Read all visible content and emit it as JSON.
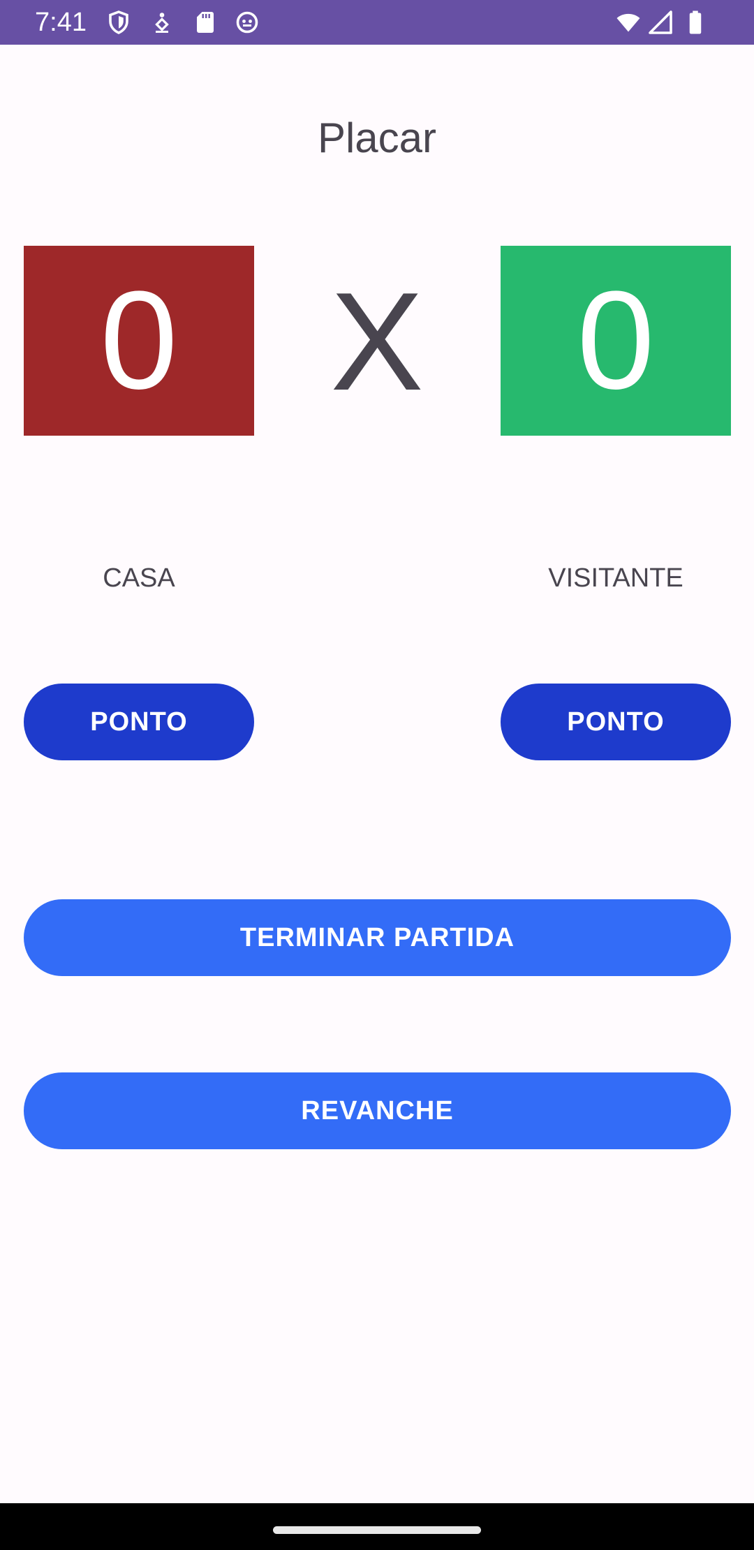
{
  "status_bar": {
    "time": "7:41",
    "background": "#6750a4",
    "left_icons": [
      "shield-icon",
      "accessibility-icon",
      "sd-card-icon",
      "robot-face-icon"
    ],
    "right_icons": [
      "wifi-icon",
      "cell-signal-icon",
      "battery-icon"
    ]
  },
  "header": {
    "title": "Placar"
  },
  "scoreboard": {
    "home_score": "0",
    "away_score": "0",
    "separator": "X",
    "home_color": "#9e2829",
    "away_color": "#27b96e"
  },
  "teams": {
    "home_label": "CASA",
    "away_label": "VISITANTE"
  },
  "buttons": {
    "home_point_label": "PONTO",
    "away_point_label": "PONTO",
    "end_match_label": "TERMINAR PARTIDA",
    "rematch_label": "REVANCHE",
    "point_color": "#1e3bcc",
    "action_color": "#336cf7"
  }
}
